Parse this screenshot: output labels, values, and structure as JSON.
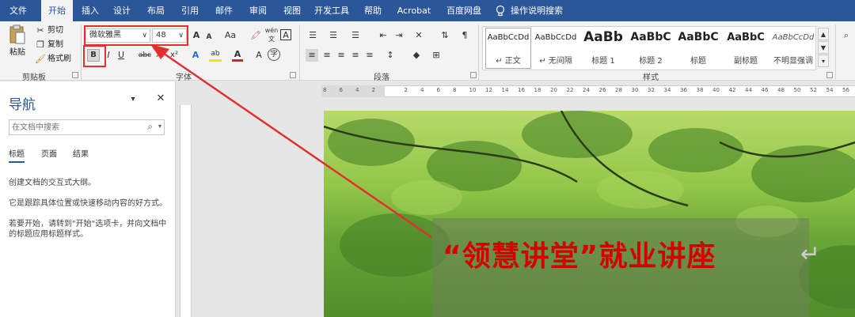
{
  "tabs": [
    "文件",
    "开始",
    "插入",
    "设计",
    "布局",
    "引用",
    "邮件",
    "审阅",
    "视图",
    "开发工具",
    "帮助",
    "Acrobat",
    "百度网盘",
    "操作说明搜索"
  ],
  "clipboard": {
    "paste": "粘贴",
    "cut": "剪切",
    "copy": "复制",
    "format_painter": "格式刷",
    "group_label": "剪贴板"
  },
  "font": {
    "name": "微软雅黑",
    "size": "48",
    "bold": "B",
    "italic": "I",
    "underline": "U",
    "strike": "abc",
    "subscript": "x₂",
    "superscript": "x²",
    "change_case": "Aa",
    "grow": "A",
    "shrink": "A",
    "phonetic": "wén 文",
    "border_char": "A",
    "highlight": "ab",
    "color": "A",
    "circled": "字",
    "group_label": "字体"
  },
  "paragraph": {
    "group_label": "段落"
  },
  "styles": {
    "group_label": "样式",
    "items": [
      {
        "sample": "AaBbCcDd",
        "name": "↵ 正文"
      },
      {
        "sample": "AaBbCcDd",
        "name": "↵ 无间隔"
      },
      {
        "sample": "AaBb",
        "name": "标题 1"
      },
      {
        "sample": "AaBbC",
        "name": "标题 2"
      },
      {
        "sample": "AaBbC",
        "name": "标题"
      },
      {
        "sample": "AaBbC",
        "name": "副标题"
      },
      {
        "sample": "AaBbCcDd",
        "name": "不明显强调"
      }
    ]
  },
  "nav": {
    "title": "导航",
    "search_placeholder": "在文档中搜索",
    "tabs": [
      "标题",
      "页面",
      "结果"
    ],
    "p1": "创建文档的交互式大纲。",
    "p2": "它是跟踪具体位置或快速移动内容的好方式。",
    "p3": "若要开始，请转到\"开始\"选项卡，并向文档中的标题应用标题样式。"
  },
  "ruler": {
    "ticks": [
      "8",
      "6",
      "4",
      "2",
      "",
      "2",
      "4",
      "6",
      "8",
      "10",
      "12",
      "14",
      "16",
      "18",
      "20",
      "22",
      "24",
      "26",
      "28",
      "30",
      "32",
      "34",
      "36",
      "38",
      "40",
      "42",
      "44",
      "46",
      "48",
      "50",
      "52",
      "54",
      "56"
    ]
  },
  "document": {
    "title": "“领慧讲堂”就业讲座"
  },
  "colors": {
    "accent": "#2b579a",
    "title_red": "#d40000",
    "annotation": "#e23030"
  }
}
